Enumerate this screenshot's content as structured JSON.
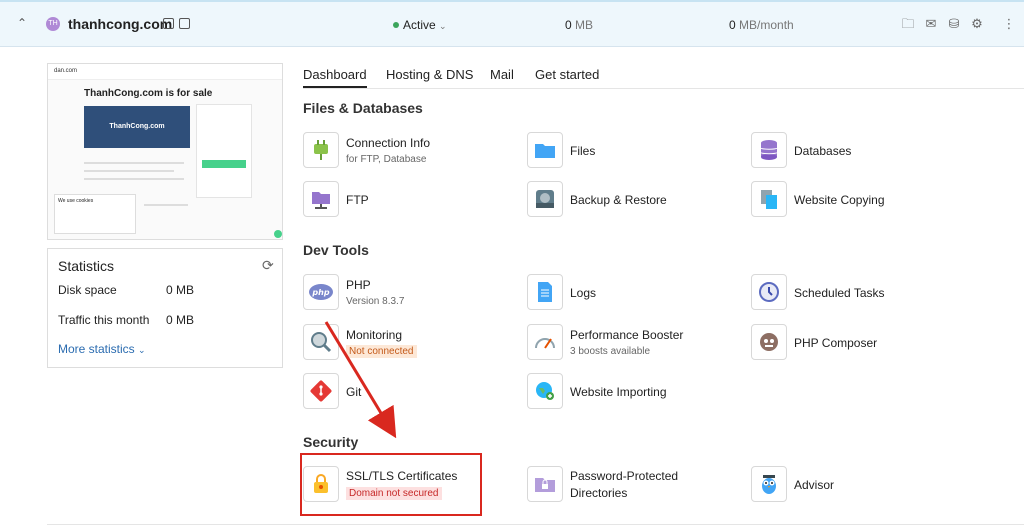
{
  "header": {
    "domain": "thanhcong.com",
    "favicon_text": "TH",
    "status": "Active",
    "disk_value": "0",
    "disk_unit": "MB",
    "traffic_value": "0",
    "traffic_unit": "MB/month"
  },
  "preview": {
    "site_label": "dan.com",
    "title": "ThanhCong.com is for sale",
    "box_text": "ThanhCong.com",
    "cookie_title": "We use cookies"
  },
  "statistics": {
    "title": "Statistics",
    "rows": [
      {
        "label": "Disk space",
        "value": "0 MB"
      },
      {
        "label": "Traffic this month",
        "value": "0 MB"
      }
    ],
    "more": "More statistics"
  },
  "tabs": [
    "Dashboard",
    "Hosting & DNS",
    "Mail",
    "Get started"
  ],
  "sections": {
    "files": {
      "title": "Files & Databases",
      "tools": [
        {
          "label": "Connection Info",
          "sub": "for FTP, Database",
          "icon": "plug-icon"
        },
        {
          "label": "Files",
          "sub": "",
          "icon": "folder-icon"
        },
        {
          "label": "Databases",
          "sub": "",
          "icon": "database-icon"
        },
        {
          "label": "FTP",
          "sub": "",
          "icon": "ftp-folder-icon"
        },
        {
          "label": "Backup & Restore",
          "sub": "",
          "icon": "backup-icon"
        },
        {
          "label": "Website Copying",
          "sub": "",
          "icon": "copy-icon"
        }
      ]
    },
    "dev": {
      "title": "Dev Tools",
      "tools": [
        {
          "label": "PHP",
          "sub": "Version 8.3.7",
          "icon": "php-icon"
        },
        {
          "label": "Logs",
          "sub": "",
          "icon": "logs-icon"
        },
        {
          "label": "Scheduled Tasks",
          "sub": "",
          "icon": "clock-icon"
        },
        {
          "label": "Monitoring",
          "sub": "Not connected",
          "icon": "monitoring-icon"
        },
        {
          "label": "Performance Booster",
          "sub": "3 boosts available",
          "icon": "gauge-icon"
        },
        {
          "label": "PHP Composer",
          "sub": "",
          "icon": "composer-icon"
        },
        {
          "label": "Git",
          "sub": "",
          "icon": "git-icon"
        },
        {
          "label": "Website Importing",
          "sub": "",
          "icon": "globe-icon"
        }
      ]
    },
    "security": {
      "title": "Security",
      "tools": [
        {
          "label": "SSL/TLS Certificates",
          "sub": "Domain not secured",
          "icon": "lock-icon"
        },
        {
          "label": "Password-Protected",
          "label2": "Directories",
          "icon": "protected-folder-icon"
        },
        {
          "label": "Advisor",
          "sub": "",
          "icon": "owl-icon"
        }
      ]
    }
  },
  "colors": {
    "accent": "#2b6cb0",
    "highlight": "#d9281f",
    "status_green": "#3ba55c"
  }
}
